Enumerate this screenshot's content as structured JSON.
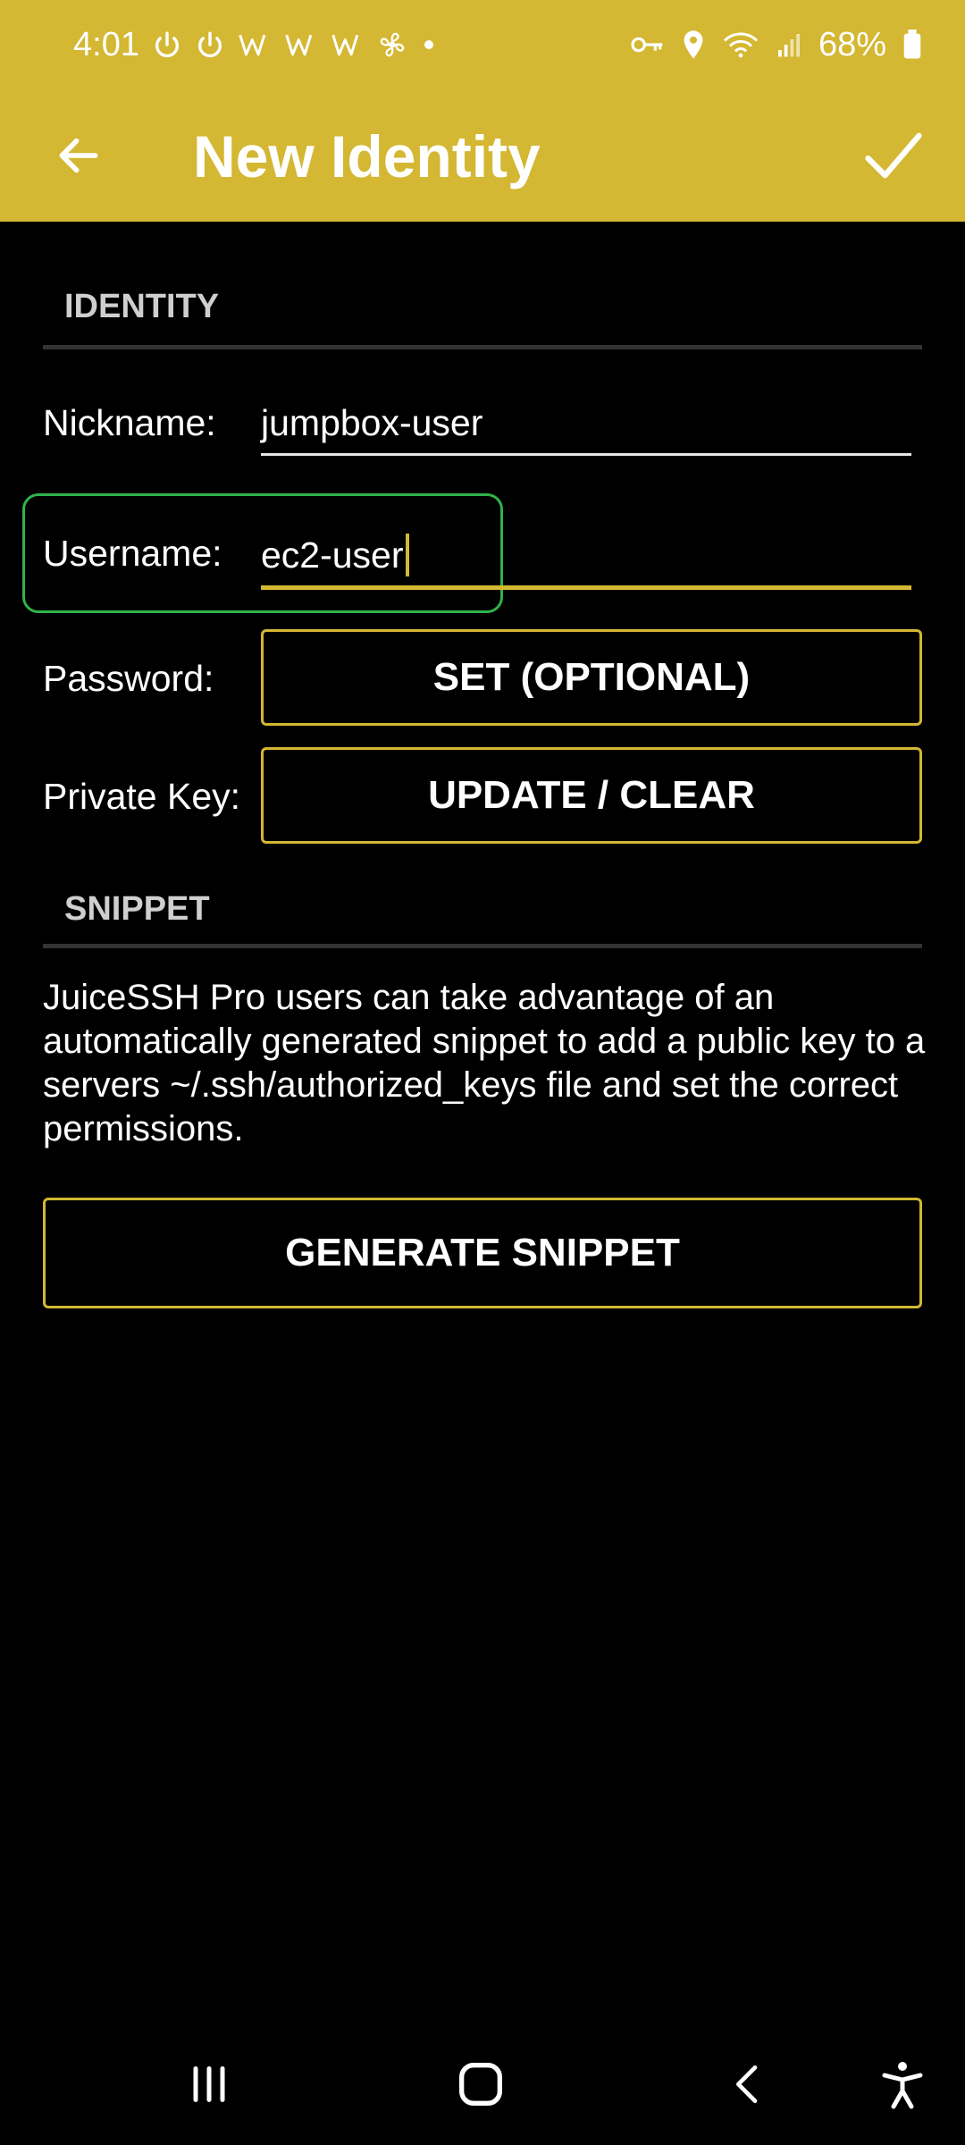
{
  "status_bar": {
    "time": "4:01",
    "battery": "68%",
    "left_icons": [
      "power-icon",
      "power-icon",
      "w-icon",
      "w-icon",
      "w-icon",
      "fan-icon",
      "dot-icon"
    ],
    "right_icons": [
      "key-icon",
      "location-icon",
      "wifi-icon",
      "signal-icon",
      "battery-icon"
    ]
  },
  "toolbar": {
    "title": "New Identity",
    "back_icon": "arrow-back-icon",
    "save_icon": "check-icon"
  },
  "identity_section": {
    "header": "IDENTITY",
    "nickname_label": "Nickname:",
    "nickname_value": "jumpbox-user",
    "username_label": "Username:",
    "username_value": "ec2-user",
    "password_label": "Password:",
    "password_button": "SET (OPTIONAL)",
    "private_key_label": "Private Key:",
    "private_key_button": "UPDATE / CLEAR"
  },
  "snippet_section": {
    "header": "SNIPPET",
    "description": "JuiceSSH Pro users can take advantage of an automatically generated snippet to add a public key to a servers ~/.ssh/authorized_keys file and set the correct permissions.",
    "generate_button": "GENERATE SNIPPET"
  },
  "colors": {
    "accent": "#d4b732",
    "background": "#000000",
    "highlight": "#2fb34a"
  },
  "nav_bar": {
    "icons": [
      "recents-icon",
      "home-icon",
      "back-nav-icon",
      "accessibility-icon"
    ]
  }
}
